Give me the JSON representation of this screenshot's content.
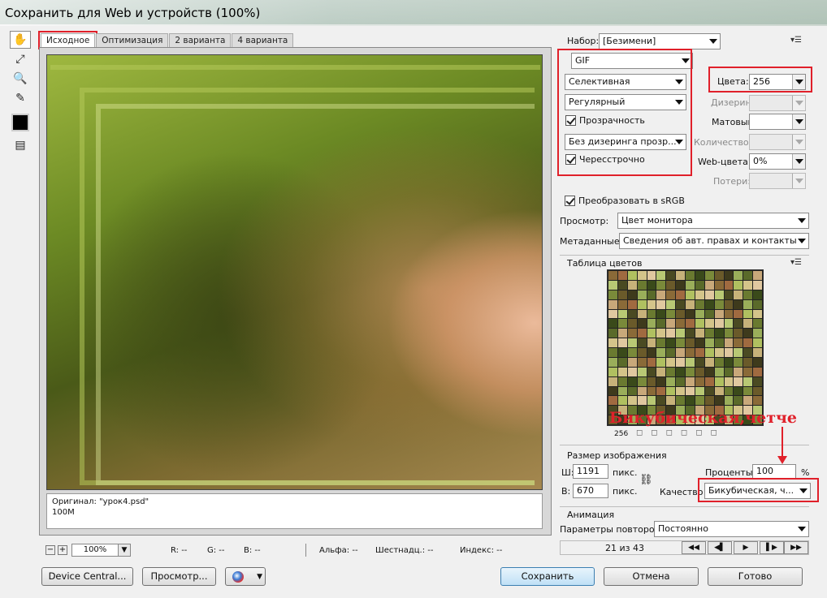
{
  "window": {
    "title": "Сохранить для Web и устройств (100%)"
  },
  "tools": {
    "items": [
      {
        "name": "hand-tool-icon",
        "glyph": "✋"
      },
      {
        "name": "slice-select-tool-icon",
        "glyph": "⤢"
      },
      {
        "name": "zoom-tool-icon",
        "glyph": "🔍"
      },
      {
        "name": "eyedropper-tool-icon",
        "glyph": "✎"
      }
    ],
    "swatch_color": "#000000",
    "toggle_slices_glyph": "▤"
  },
  "tabs": [
    {
      "label": "Исходное"
    },
    {
      "label": "Оптимизация"
    },
    {
      "label": "2 варианта"
    },
    {
      "label": "4 варианта"
    }
  ],
  "preview": {
    "info_line1": "Оригинал: \"урок4.psd\"",
    "info_line2": "100M"
  },
  "statusbar": {
    "zoom_minus": "−",
    "zoom_plus": "+",
    "zoom_value": "100%",
    "r": "R: --",
    "g": "G: --",
    "b": "B: --",
    "alpha": "Альфа: --",
    "hex": "Шестнадц.: --",
    "index": "Индекс: --"
  },
  "buttons": {
    "device_central": "Device Central...",
    "preview": "Просмотр...",
    "save": "Сохранить",
    "cancel": "Отмена",
    "done": "Готово"
  },
  "settings": {
    "preset_label": "Набор:",
    "preset_value": "[Безимени]",
    "format": "GIF",
    "reduction": "Селективная",
    "dither_algo": "Регулярный",
    "transparency_label": "Прозрачность",
    "transparency_checked": true,
    "transparency_dither": "Без дизеринга прозр...",
    "interlaced_label": "Чересстрочно",
    "interlaced_checked": true,
    "colors_label": "Цвета:",
    "colors_value": "256",
    "dither_label": "Дизеринг:",
    "matte_label": "Матовый:",
    "amount_label": "Количество:",
    "websnap_label": "Web-цвета:",
    "websnap_value": "0%",
    "lossy_label": "Потери:",
    "convert_srgb_label": "Преобразовать в sRGB",
    "convert_srgb_checked": true,
    "preview_label": "Просмотр:",
    "preview_value": "Цвет монитора",
    "metadata_label": "Метаданные:",
    "metadata_value": "Сведения об авт. правах и контакты"
  },
  "color_table": {
    "title": "Таблица цветов",
    "count": "256",
    "colors": [
      "#8a6a38",
      "#c7b27a",
      "#5a6a2a",
      "#b8c874",
      "#3e3a1c",
      "#d4c48a",
      "#7a8a3a",
      "#a06a40",
      "#6a7a30",
      "#c8a87a",
      "#4a4a22",
      "#9aae5a",
      "#e0c8a0",
      "#6a5a2a",
      "#b0c060",
      "#3a4a1a"
    ]
  },
  "image_size": {
    "title": "Размер изображения",
    "w_label": "Ш:",
    "w_value": "1191",
    "h_label": "В:",
    "h_value": "670",
    "unit": "пикс.",
    "percent_label": "Проценты:",
    "percent_value": "100",
    "percent_sign": "%",
    "quality_label": "Качество",
    "quality_value": "Бикубическая, ч..."
  },
  "annotation": {
    "text": "Бикубическая,четче"
  },
  "animation": {
    "title": "Анимация",
    "loop_label": "Параметры повторов:",
    "loop_value": "Постоянно",
    "frame_counter": "21 из 43",
    "controls": [
      "◀◀",
      "◀▌",
      "▶",
      "▌▶",
      "▶▶"
    ]
  }
}
